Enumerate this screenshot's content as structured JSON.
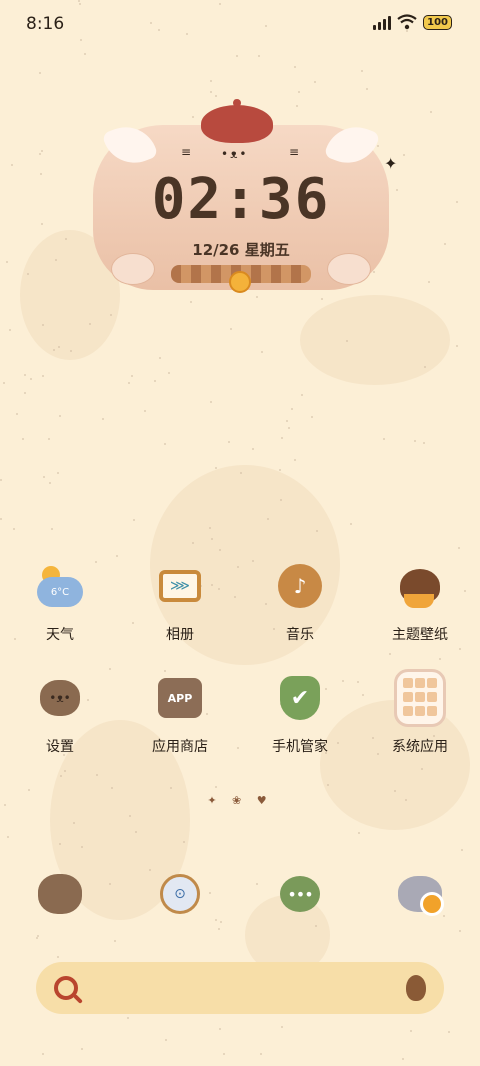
{
  "status_bar": {
    "time": "8:16",
    "battery": "100"
  },
  "clock_widget": {
    "time": "02:36",
    "date": "12/26  星期五"
  },
  "apps_row1": [
    {
      "label": "天气",
      "icon": "weather-icon",
      "glyph": "6°C"
    },
    {
      "label": "相册",
      "icon": "album-icon",
      "glyph": ""
    },
    {
      "label": "音乐",
      "icon": "music-icon",
      "glyph": ""
    },
    {
      "label": "主题壁纸",
      "icon": "theme-icon",
      "glyph": ""
    }
  ],
  "apps_row2": [
    {
      "label": "设置",
      "icon": "settings-icon",
      "glyph": ""
    },
    {
      "label": "应用商店",
      "icon": "app-store-icon",
      "glyph": "APP"
    },
    {
      "label": "手机管家",
      "icon": "security-icon",
      "glyph": "✔"
    },
    {
      "label": "系统应用",
      "icon": "system-apps-icon",
      "glyph": ""
    }
  ],
  "dock": [
    {
      "icon": "phone-icon"
    },
    {
      "icon": "browser-icon"
    },
    {
      "icon": "messages-icon"
    },
    {
      "icon": "camera-icon"
    }
  ],
  "search": {
    "placeholder": ""
  },
  "colors": {
    "background": "#fcefd6",
    "search_bar": "#f7dea8",
    "accent": "#b9452e"
  }
}
